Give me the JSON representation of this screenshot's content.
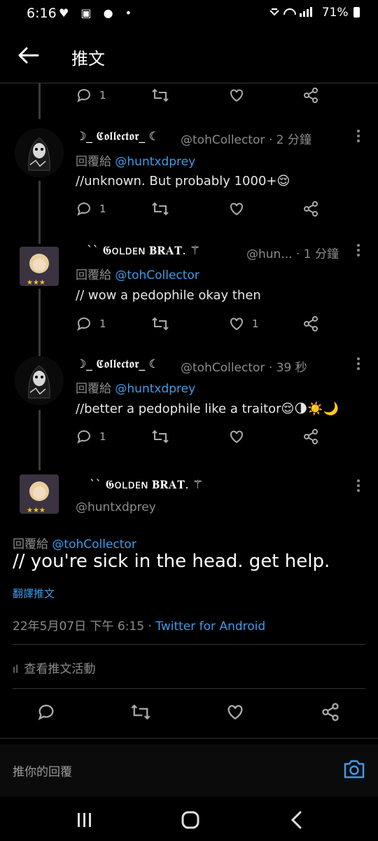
{
  "status_bar": {
    "time": "6:16",
    "left_icons": "♥ ▣ ● •",
    "battery": "71%"
  },
  "header": {
    "title": "推文"
  },
  "tweets": [
    {
      "name": "☽_ 𝕮𝖔𝖑𝖑𝖊𝖈𝖙𝖔𝖗_ ☾",
      "handle": "@tohCollector · 2 分鐘",
      "reply_prefix": "回覆給 ",
      "reply_to": "@huntxdprey",
      "text": "//unknown. But probably 1000+😌",
      "replies": "1",
      "likes": ""
    },
    {
      "name": "`` 𝕲ᴏʟᴅᴇɴ 𝐁𝐑𝐀𝐓. ⚚",
      "handle": "@hun... · 1 分鐘",
      "reply_prefix": "回覆給 ",
      "reply_to": "@tohCollector",
      "text": "// wow a pedophile okay then",
      "replies": "1",
      "likes": "1"
    },
    {
      "name": "☽_ 𝕮𝖔𝖑𝖑𝖊𝖈𝖙𝖔𝖗_ ☾",
      "handle": "@tohCollector · 39 秒",
      "reply_prefix": "回覆給 ",
      "reply_to": "@huntxdprey",
      "text": "//better a pedophile like a traitor😌🌗☀️🌙",
      "replies": "1",
      "likes": ""
    }
  ],
  "top_partial": {
    "replies": "1"
  },
  "main": {
    "name": "`` 𝕲ᴏʟᴅᴇɴ 𝐁𝐑𝐀𝐓. ⚚",
    "handle": "@huntxdprey",
    "reply_prefix": "回覆給 ",
    "reply_to": "@tohCollector",
    "text": "// you're sick in the head. get help.",
    "translate": "翻譯推文",
    "date": "22年5月07日 下午 6:15 · ",
    "client": "Twitter for Android",
    "activity": "查看推文活動"
  },
  "reply_box": {
    "placeholder": "推你的回覆"
  },
  "accent_color": "#3f9be8"
}
